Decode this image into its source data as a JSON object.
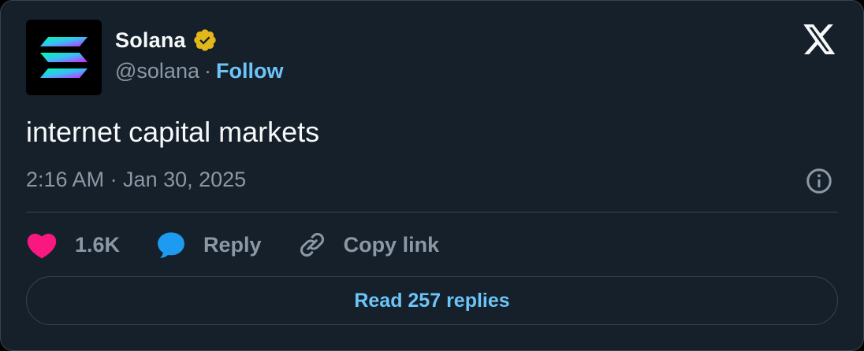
{
  "author": {
    "display_name": "Solana",
    "handle": "@solana",
    "separator": "·",
    "follow_label": "Follow",
    "verified": true
  },
  "tweet": {
    "text": "internet capital markets",
    "timestamp": "2:16 AM · Jan 30, 2025"
  },
  "actions": {
    "likes_count": "1.6K",
    "reply_label": "Reply",
    "copy_link_label": "Copy link"
  },
  "footer": {
    "read_replies_label": "Read 257 replies"
  },
  "colors": {
    "background": "#15202b",
    "border": "#38444d",
    "text_primary": "#f7f9f9",
    "text_secondary": "#8b98a5",
    "accent_blue": "#1d9bf0",
    "like_pink": "#f91880",
    "verified_gold": "#e2b719"
  },
  "icons": {
    "brand": "x-logo-icon",
    "avatar": "solana-logo-icon",
    "verified": "verified-badge-icon",
    "info": "info-icon",
    "like": "heart-icon",
    "reply": "speech-bubble-icon",
    "copy": "link-icon"
  }
}
